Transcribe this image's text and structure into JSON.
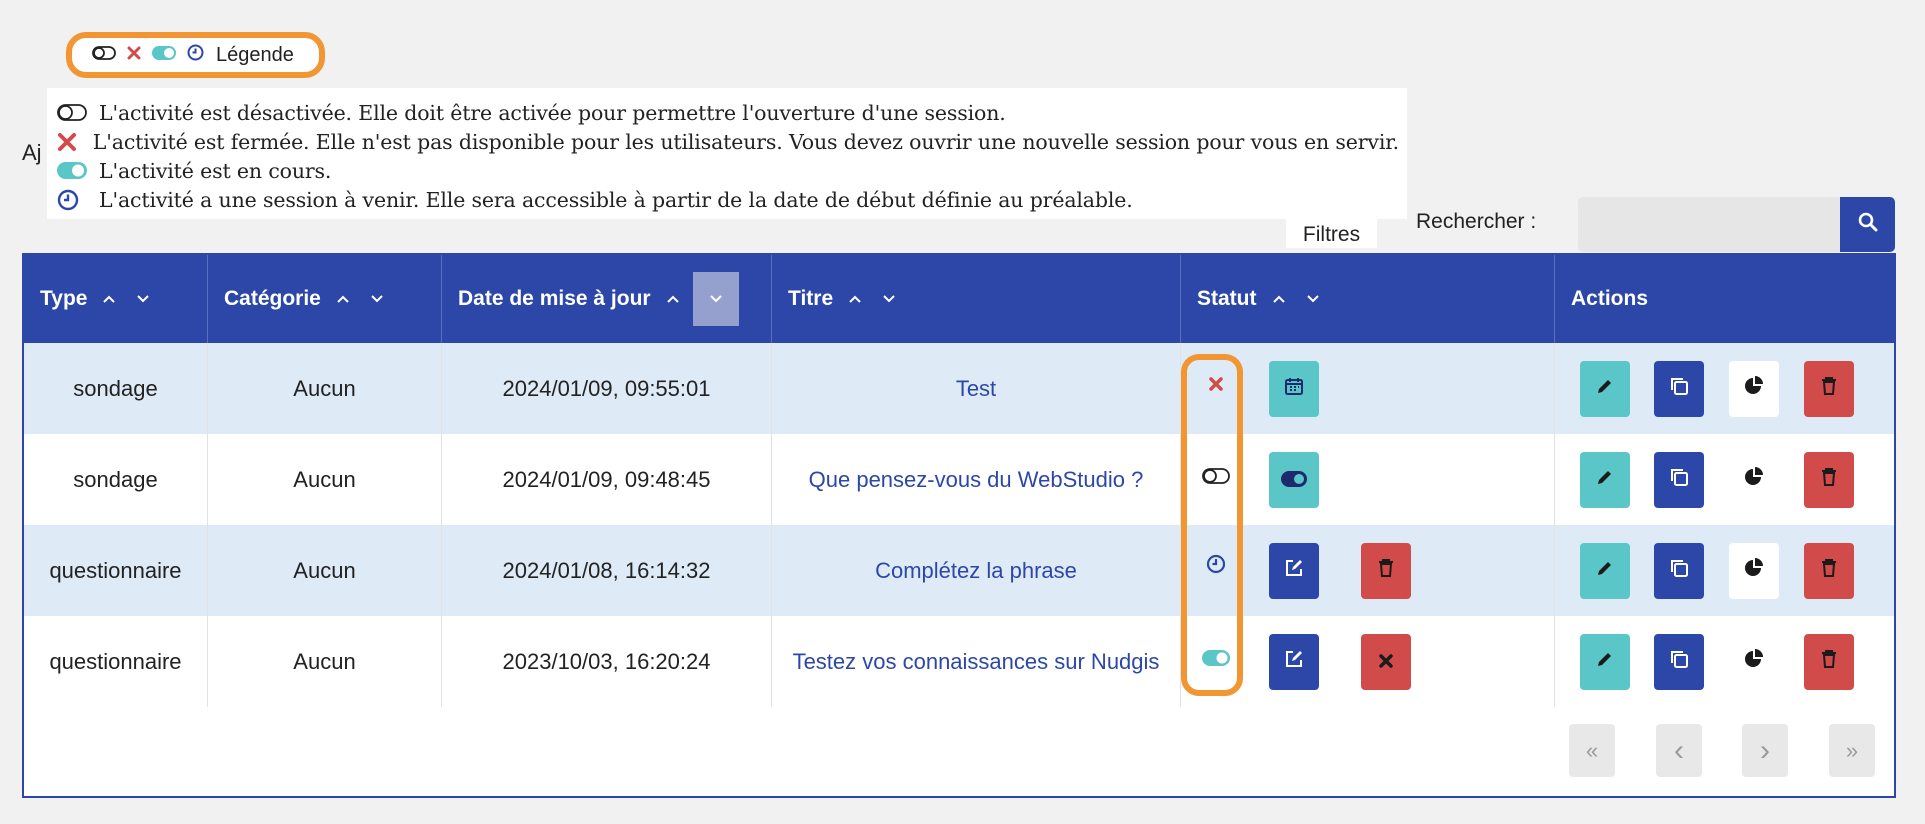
{
  "legend": {
    "button_label": "Légende",
    "items": [
      {
        "icon": "toggle-off-icon",
        "text": "L'activité est désactivée. Elle doit être activée pour permettre l'ouverture d'une session."
      },
      {
        "icon": "close-icon",
        "text": "L'activité est fermée. Elle n'est pas disponible pour les utilisateurs. Vous devez ouvrir une nouvelle session pour vous en servir."
      },
      {
        "icon": "toggle-on-icon",
        "text": "L'activité est en cours."
      },
      {
        "icon": "clock-icon",
        "text": "L'activité a une session à venir. Elle sera accessible à partir de la date de début définie au préalable."
      }
    ]
  },
  "add_text": "Aj",
  "toolbar": {
    "filters_label": "Filtres",
    "search_label": "Rechercher :",
    "search_placeholder": ""
  },
  "table": {
    "columns": [
      "Type",
      "Catégorie",
      "Date de mise à jour",
      "Titre",
      "Statut",
      "Actions"
    ],
    "rows": [
      {
        "type": "sondage",
        "category": "Aucun",
        "date": "2024/01/09, 09:55:01",
        "title": "Test",
        "status": "closed"
      },
      {
        "type": "sondage",
        "category": "Aucun",
        "date": "2024/01/09, 09:48:45",
        "title": "Que pensez-vous du WebStudio ?",
        "status": "disabled"
      },
      {
        "type": "questionnaire",
        "category": "Aucun",
        "date": "2024/01/08, 16:14:32",
        "title": "Complétez la phrase",
        "status": "upcoming"
      },
      {
        "type": "questionnaire",
        "category": "Aucun",
        "date": "2023/10/03, 16:20:24",
        "title": "Testez vos connaissances sur Nudgis",
        "status": "running"
      }
    ]
  },
  "pagination": {
    "first": "«",
    "prev": "‹",
    "next": "›",
    "last": "»"
  },
  "colors": {
    "primary": "#2d47a8",
    "teal": "#5bc6c8",
    "red": "#d24b4b",
    "highlight": "#f29533",
    "row_alt": "#deebf7"
  }
}
